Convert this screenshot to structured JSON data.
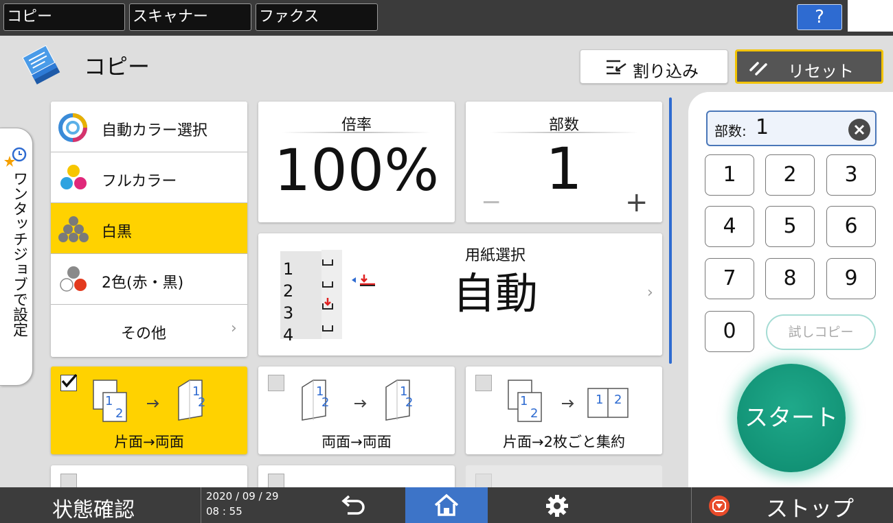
{
  "topbar": {
    "tabs": [
      "コピー",
      "スキャナー",
      "ファクス"
    ],
    "help_label": "?"
  },
  "header": {
    "title": "コピー",
    "interrupt_label": "割り込み",
    "reset_label": "リセット"
  },
  "side_tab": {
    "label": "ワンタッチジョブで設定"
  },
  "color_modes": {
    "items": [
      "自動カラー選択",
      "フルカラー",
      "白黒",
      "2色(赤・黒)"
    ],
    "selected": "白黒",
    "other_label": "その他"
  },
  "zoom": {
    "title": "倍率",
    "value": "100%"
  },
  "copies": {
    "title": "部数",
    "value": "1",
    "minus": "−",
    "plus": "+"
  },
  "paper": {
    "title": "用紙選択",
    "value": "自動",
    "trays": [
      "1",
      "2",
      "3",
      "4"
    ],
    "arrow": "›"
  },
  "duplex_options": [
    {
      "label": "片面→両面",
      "checked": true,
      "from": [
        "1",
        "2"
      ],
      "to": [
        "1",
        "2"
      ]
    },
    {
      "label": "両面→両面",
      "checked": false,
      "from": [
        "1",
        "2"
      ],
      "to": [
        "1",
        "2"
      ]
    },
    {
      "label": "片面→2枚ごと集約",
      "checked": false,
      "from": [
        "1",
        "2"
      ],
      "to": [
        "1",
        "2"
      ]
    }
  ],
  "keypad": {
    "field_label": "部数:",
    "field_value": "1",
    "keys": [
      "1",
      "2",
      "3",
      "4",
      "5",
      "6",
      "7",
      "8",
      "9",
      "0"
    ],
    "trial_copy_label": "試しコピー",
    "start_label": "スタート"
  },
  "bottombar": {
    "status_label": "状態確認",
    "date": "2020 / 09 / 29",
    "time": "08 : 55",
    "stop_label": "ストップ"
  },
  "colors": {
    "accent_yellow": "#ffd200",
    "start_green": "#12997b",
    "home_blue": "#3d74c8",
    "stop_red": "#e84b2a"
  }
}
